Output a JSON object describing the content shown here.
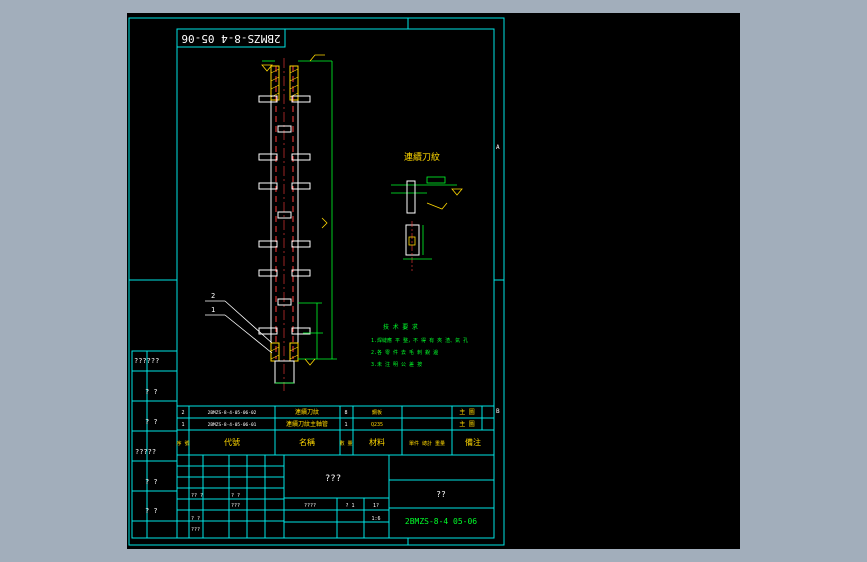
{
  "colors": {
    "app_background": "#a2aebb",
    "viewport_background": "#000000",
    "frame": "#00e5e5",
    "part": "#ffffff",
    "hidden_dash": "#ff3b3b",
    "dimension": "#00ff2a",
    "annotation": "#ffd800",
    "text": "#00ff2a",
    "text_white": "#ffffff"
  },
  "drawing": {
    "stamp_number": "2BMZS-8-4 05-06",
    "detail_title": "連續刀紋",
    "callouts": [
      "2",
      "1"
    ],
    "tech_notes": [
      "技 术 要 求",
      "1.焊縫應 平 整，不 得 有 夾 渣、氣 孔",
      "2.各 零 件 去 毛 刺 銳 邊",
      "3.未 注 明 公 差 按"
    ]
  },
  "side_marks": {
    "left": [
      "??????",
      "? ?",
      "? ?",
      "?????",
      "? ?",
      "? ?"
    ]
  },
  "border_marks": {
    "a": "A",
    "b": "B"
  },
  "title_block": {
    "parts_rows": [
      {
        "num": "2",
        "code": "2BMZS-8-4-05-06-02",
        "name": "連續刀紋",
        "qty": "8",
        "material": "鋼板",
        "note": "主 圖"
      },
      {
        "num": "1",
        "code": "2BMZS-8-4-05-06-01",
        "name": "連續刀紋主軸管",
        "qty": "1",
        "material": "Q235",
        "note": "主 圖"
      }
    ],
    "header": {
      "num": "序 號",
      "code": "代號",
      "name": "名稱",
      "qty": "數 量",
      "material": "材料",
      "weight": "單件 總計 重量",
      "note": "備注"
    },
    "center_title": "???",
    "right_title": "??",
    "drawing_number": "2BMZS-8-4 05-06",
    "scale_marks": [
      "????",
      "? 1",
      "1?",
      "1:6"
    ],
    "sign_rows": [
      "?? ?",
      "? ?",
      "???",
      "? ?",
      "???"
    ]
  }
}
